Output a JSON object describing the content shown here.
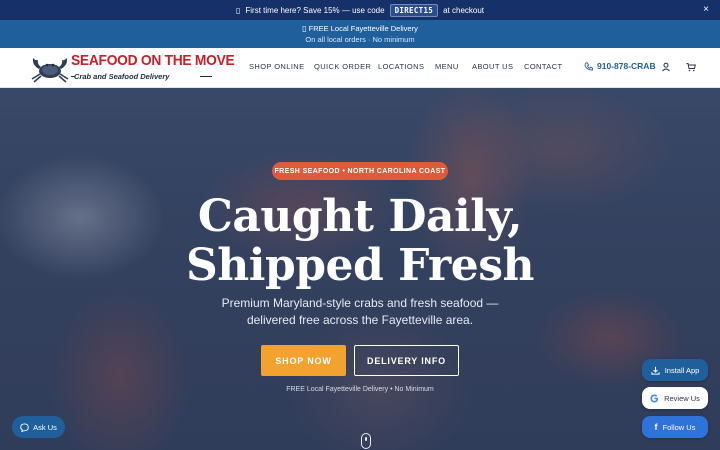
{
  "promo": {
    "icon": "gift-icon",
    "text_before": "First time here? Save 15% — use code",
    "code": "DIRECT15",
    "text_after": "at checkout",
    "close_label": "×"
  },
  "delivery_bar": {
    "icon": "truck-icon",
    "title": "FREE Local Fayetteville Delivery",
    "subtitle": "On all local orders · No minimum"
  },
  "brand": {
    "name": "SEAFOOD ON THE MOVE",
    "tagline": "Crab and Seafood Delivery",
    "colors": {
      "red": "#c8202a",
      "navy": "#1c2b3e",
      "blue": "#1f5f9c",
      "orange": "#f3a12f"
    }
  },
  "nav": {
    "items": [
      "SHOP ONLINE",
      "QUICK ORDER",
      "LOCATIONS",
      "MENU",
      "ABOUT US",
      "CONTACT"
    ],
    "phone": "910-878-CRAB"
  },
  "hero": {
    "badge": "FRESH SEAFOOD • NORTH CAROLINA COAST",
    "title_line1": "Caught Daily,",
    "title_line2": "Shipped Fresh",
    "subtitle": "Premium Maryland-style crabs and fresh seafood — delivered free across the Fayetteville area.",
    "primary_cta": "SHOP NOW",
    "secondary_cta": "DELIVERY INFO",
    "note": "FREE Local Fayetteville Delivery • No Minimum"
  },
  "widgets": {
    "ask": "Ask Us",
    "install": "Install App",
    "review": "Review Us",
    "follow": "Follow Us"
  }
}
